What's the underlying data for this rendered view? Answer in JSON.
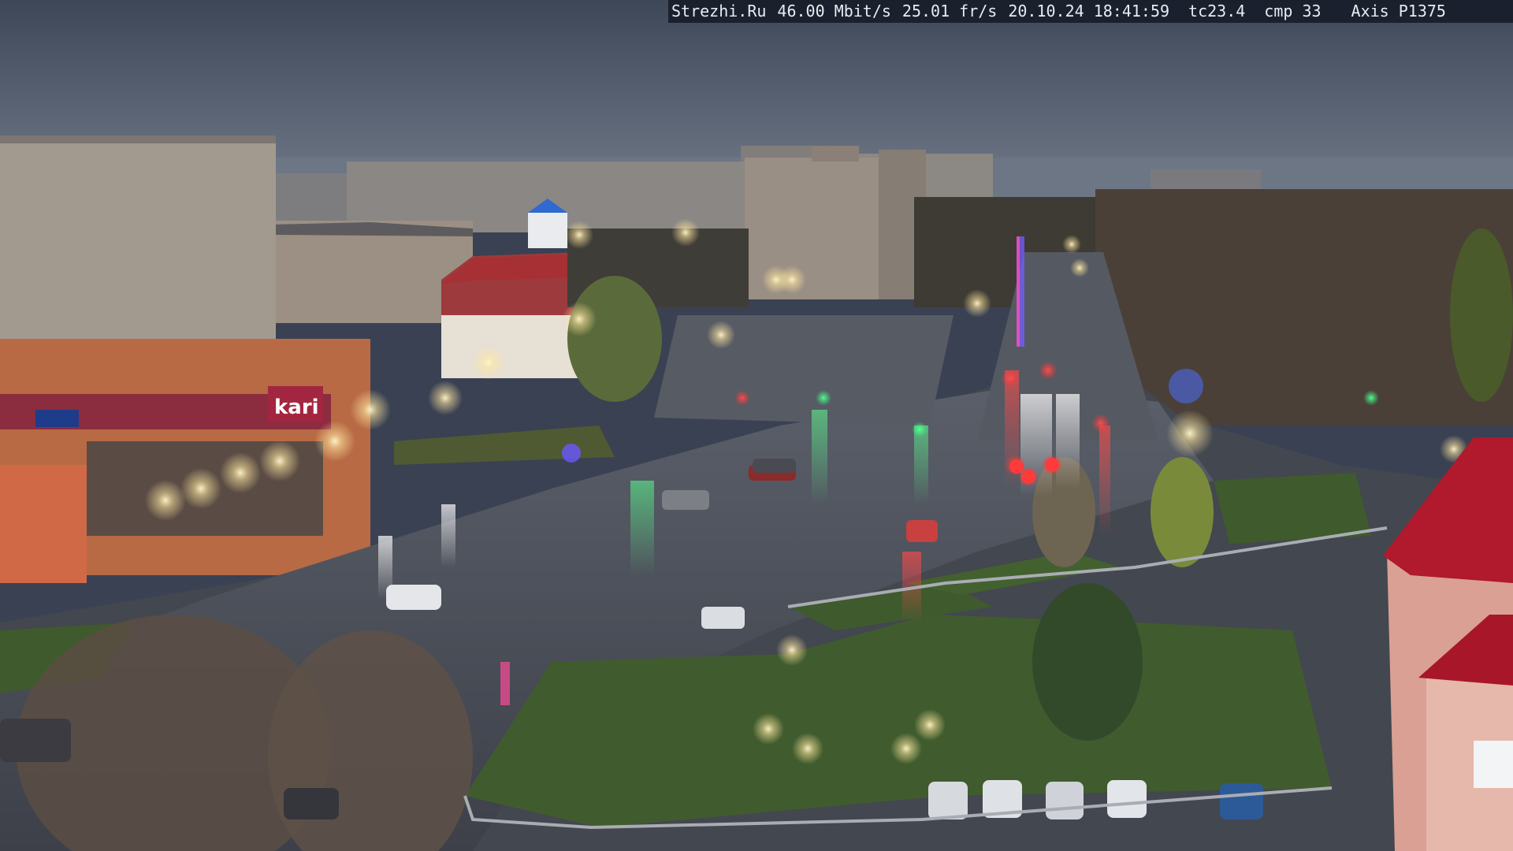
{
  "overlay": {
    "site": "Strezhi.Ru",
    "bitrate": "46.00 Mbit/s",
    "framerate": "25.01 fr/s",
    "datetime": "20.10.24 18:41:59",
    "tc": "tc23.4",
    "cmp": "cmp 33",
    "camera": "Axis P1375"
  },
  "signage": {
    "store_sign": "kari"
  },
  "colors": {
    "sky": "#4b5566",
    "sky_low": "#6a7383",
    "road": "#4a4e58",
    "grass": "#3f5a2c",
    "facade_red": "#a43a3d",
    "facade_orange": "#c76a3c",
    "lamp": "#fff6d2"
  }
}
